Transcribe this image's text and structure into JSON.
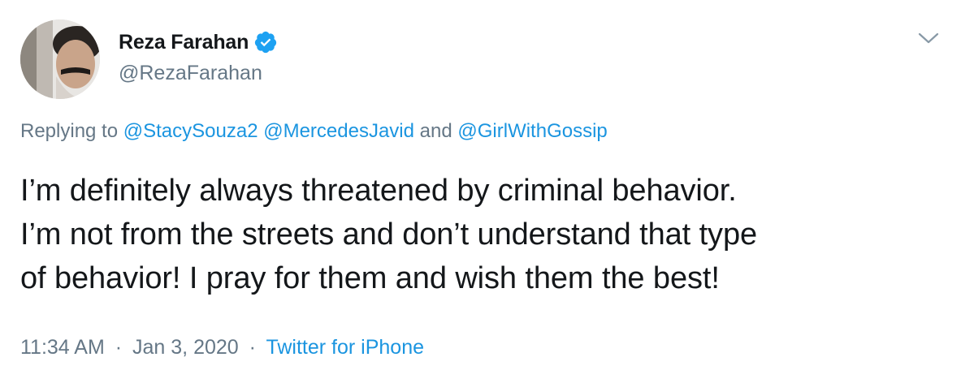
{
  "author": {
    "display_name": "Reza Farahan",
    "handle": "@RezaFarahan",
    "verified": true,
    "avatar_icon": "profile-photo"
  },
  "replying": {
    "prefix": "Replying to",
    "mentions": [
      "@StacySouza2",
      "@MercedesJavid",
      "@GirlWithGossip"
    ],
    "conjunction": "and"
  },
  "tweet": {
    "lines": [
      "I’m definitely always threatened by criminal behavior.",
      "I’m not from the streets and don’t understand that type",
      "of behavior! I pray for them and wish them the best!"
    ]
  },
  "meta": {
    "time": "11:34 AM",
    "separator": "·",
    "date": "Jan 3, 2020",
    "source": "Twitter for iPhone"
  },
  "colors": {
    "accent": "#1b95e0",
    "secondary_text": "#657786",
    "primary_text": "#14171a",
    "verified_badge": "#1da1f2"
  },
  "icons": {
    "menu": "chevron-down-icon",
    "verified": "verified-badge-icon"
  }
}
